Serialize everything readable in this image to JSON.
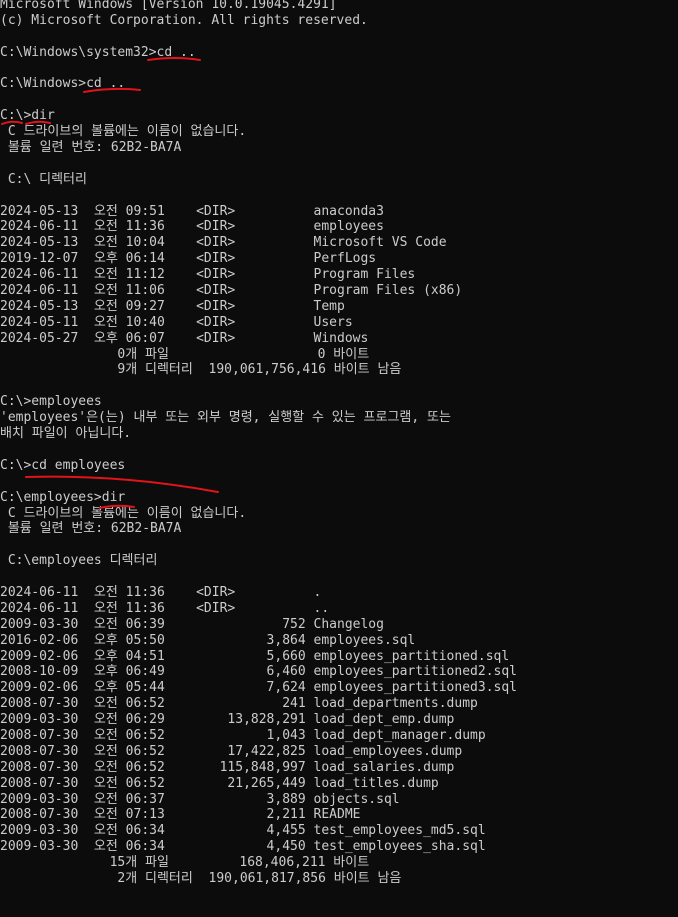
{
  "terminal": {
    "lines": [
      "Microsoft Windows [Version 10.0.19045.4291]",
      "(c) Microsoft Corporation. All rights reserved.",
      "",
      "C:\\Windows\\system32>cd ..",
      "",
      "C:\\Windows>cd ..",
      "",
      "C:\\>dir",
      " C 드라이브의 볼륨에는 이름이 없습니다.",
      " 볼륨 일련 번호: 62B2-BA7A",
      "",
      " C:\\ 디렉터리",
      "",
      "2024-05-13  오전 09:51    <DIR>          anaconda3",
      "2024-06-11  오전 11:36    <DIR>          employees",
      "2024-05-13  오전 10:04    <DIR>          Microsoft VS Code",
      "2019-12-07  오후 06:14    <DIR>          PerfLogs",
      "2024-06-11  오전 11:12    <DIR>          Program Files",
      "2024-06-11  오전 11:06    <DIR>          Program Files (x86)",
      "2024-05-13  오전 09:27    <DIR>          Temp",
      "2024-05-11  오전 10:40    <DIR>          Users",
      "2024-05-27  오후 06:07    <DIR>          Windows",
      "               0개 파일                   0 바이트",
      "               9개 디렉터리  190,061,756,416 바이트 남음",
      "",
      "C:\\>employees",
      "'employees'은(는) 내부 또는 외부 명령, 실행할 수 있는 프로그램, 또는",
      "배치 파일이 아닙니다.",
      "",
      "C:\\>cd employees",
      "",
      "C:\\employees>dir",
      " C 드라이브의 볼륨에는 이름이 없습니다.",
      " 볼륨 일련 번호: 62B2-BA7A",
      "",
      " C:\\employees 디렉터리",
      "",
      "2024-06-11  오전 11:36    <DIR>          .",
      "2024-06-11  오전 11:36    <DIR>          ..",
      "2009-03-30  오전 06:39               752 Changelog",
      "2016-02-06  오후 05:50             3,864 employees.sql",
      "2009-02-06  오후 04:51             5,660 employees_partitioned.sql",
      "2008-10-09  오후 06:49             6,460 employees_partitioned2.sql",
      "2009-02-06  오후 05:44             7,624 employees_partitioned3.sql",
      "2008-07-30  오전 06:52               241 load_departments.dump",
      "2009-03-30  오전 06:29        13,828,291 load_dept_emp.dump",
      "2008-07-30  오전 06:52             1,043 load_dept_manager.dump",
      "2008-07-30  오전 06:52        17,422,825 load_employees.dump",
      "2008-07-30  오전 06:52       115,848,997 load_salaries.dump",
      "2008-07-30  오전 06:52        21,265,449 load_titles.dump",
      "2009-03-30  오전 06:37             3,889 objects.sql",
      "2008-07-30  오전 07:13             2,211 README",
      "2009-03-30  오전 06:34             4,455 test_employees_md5.sql",
      "2009-03-30  오전 06:34             4,450 test_employees_sha.sql",
      "              15개 파일         168,406,211 바이트",
      "               2개 디렉터리  190,061,817,856 바이트 남음"
    ]
  },
  "colors": {
    "background": "#0c0c0c",
    "text": "#cccccc",
    "annotation": "#e0141a"
  }
}
